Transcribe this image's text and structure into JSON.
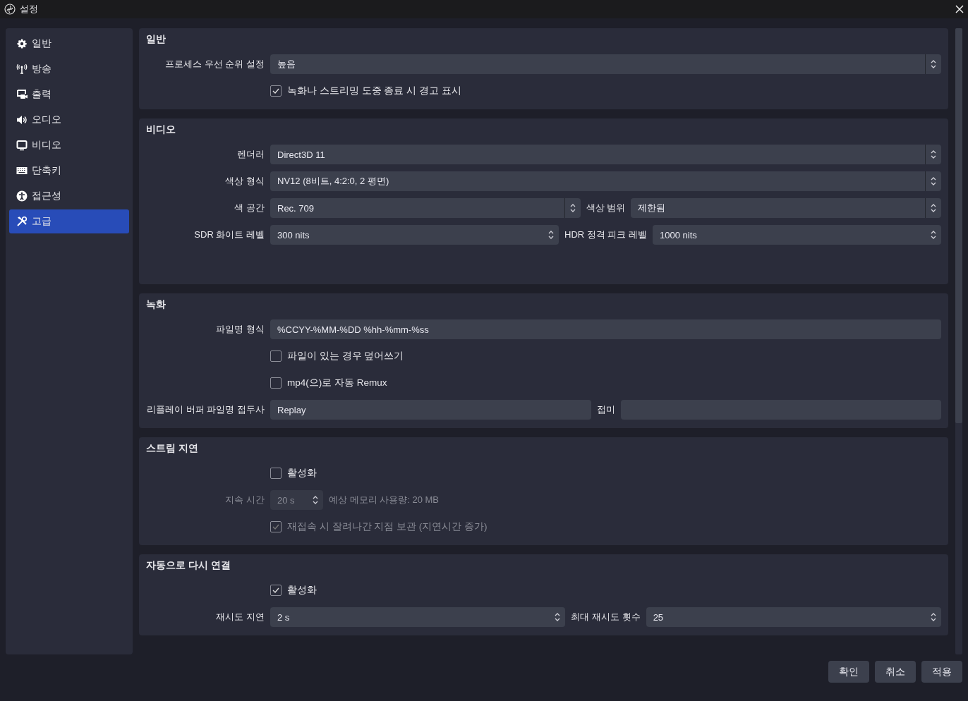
{
  "window": {
    "title": "설정"
  },
  "sidebar": {
    "items": [
      {
        "label": "일반",
        "selected": false
      },
      {
        "label": "방송",
        "selected": false
      },
      {
        "label": "출력",
        "selected": false
      },
      {
        "label": "오디오",
        "selected": false
      },
      {
        "label": "비디오",
        "selected": false
      },
      {
        "label": "단축키",
        "selected": false
      },
      {
        "label": "접근성",
        "selected": false
      },
      {
        "label": "고급",
        "selected": true
      }
    ]
  },
  "sections": [
    {
      "title": "일반",
      "rows": [
        {
          "label": "프로세스 우선 순위 설정",
          "disabled": false,
          "fields": [
            {
              "kind": "select",
              "value": "높음"
            }
          ]
        },
        {
          "disabled": false,
          "fields": [
            {
              "kind": "check",
              "label": "녹화나 스트리밍 도중 종료 시 경고 표시",
              "checked": true
            }
          ]
        }
      ]
    },
    {
      "title": "비디오",
      "rows": [
        {
          "label": "렌더러",
          "disabled": false,
          "fields": [
            {
              "kind": "select",
              "value": "Direct3D 11"
            }
          ]
        },
        {
          "label": "색상 형식",
          "disabled": false,
          "fields": [
            {
              "kind": "select",
              "value": "NV12 (8비트, 4:2:0, 2 평면)"
            }
          ]
        },
        {
          "label": "색 공간",
          "disabled": false,
          "fields": [
            {
              "kind": "select",
              "value": "Rec. 709"
            },
            {
              "kind": "select",
              "label": "색상 범위",
              "value": "제한됨"
            }
          ]
        },
        {
          "label": "SDR 화이트 레벨",
          "disabled": false,
          "fields": [
            {
              "kind": "spin",
              "value": "300 nits"
            },
            {
              "kind": "spin",
              "label": "HDR 정격 피크 레벨",
              "value": "1000 nits"
            }
          ]
        }
      ]
    },
    {
      "title": "녹화",
      "rows": [
        {
          "label": "파일명 형식",
          "disabled": false,
          "fields": [
            {
              "kind": "text",
              "value": "%CCYY-%MM-%DD %hh-%mm-%ss"
            }
          ]
        },
        {
          "disabled": false,
          "fields": [
            {
              "kind": "check",
              "label": "파일이 있는 경우 덮어쓰기",
              "checked": false
            }
          ]
        },
        {
          "disabled": false,
          "fields": [
            {
              "kind": "check",
              "label": "mp4(으)로 자동 Remux",
              "checked": false
            }
          ]
        },
        {
          "label": "리플레이 버퍼 파일명 접두사",
          "disabled": false,
          "fields": [
            {
              "kind": "text",
              "value": "Replay"
            },
            {
              "kind": "text",
              "label": "접미"
            }
          ]
        }
      ]
    },
    {
      "title": "스트림 지연",
      "rows": [
        {
          "disabled": false,
          "fields": [
            {
              "kind": "check",
              "label": "활성화",
              "checked": false
            }
          ]
        },
        {
          "label": "지속 시간",
          "disabled": true,
          "fields": [
            {
              "kind": "spin",
              "value": "20 s"
            },
            {
              "kind": "note",
              "value": "예상 메모리 사용량: 20 MB"
            }
          ]
        },
        {
          "disabled": true,
          "fields": [
            {
              "kind": "check",
              "label": "재접속 시 잘려나간 지점 보관 (지연시간 증가)",
              "checked": true
            }
          ]
        }
      ]
    },
    {
      "title": "자동으로 다시 연결",
      "rows": [
        {
          "disabled": false,
          "fields": [
            {
              "kind": "check",
              "label": "활성화",
              "checked": true
            }
          ]
        },
        {
          "label": "재시도 지연",
          "disabled": false,
          "fields": [
            {
              "kind": "spin",
              "value": "2 s"
            },
            {
              "kind": "spin",
              "label": "최대 재시도 횟수",
              "value": "25"
            }
          ]
        }
      ]
    }
  ],
  "buttons": [
    "확인",
    "취소",
    "적용"
  ]
}
